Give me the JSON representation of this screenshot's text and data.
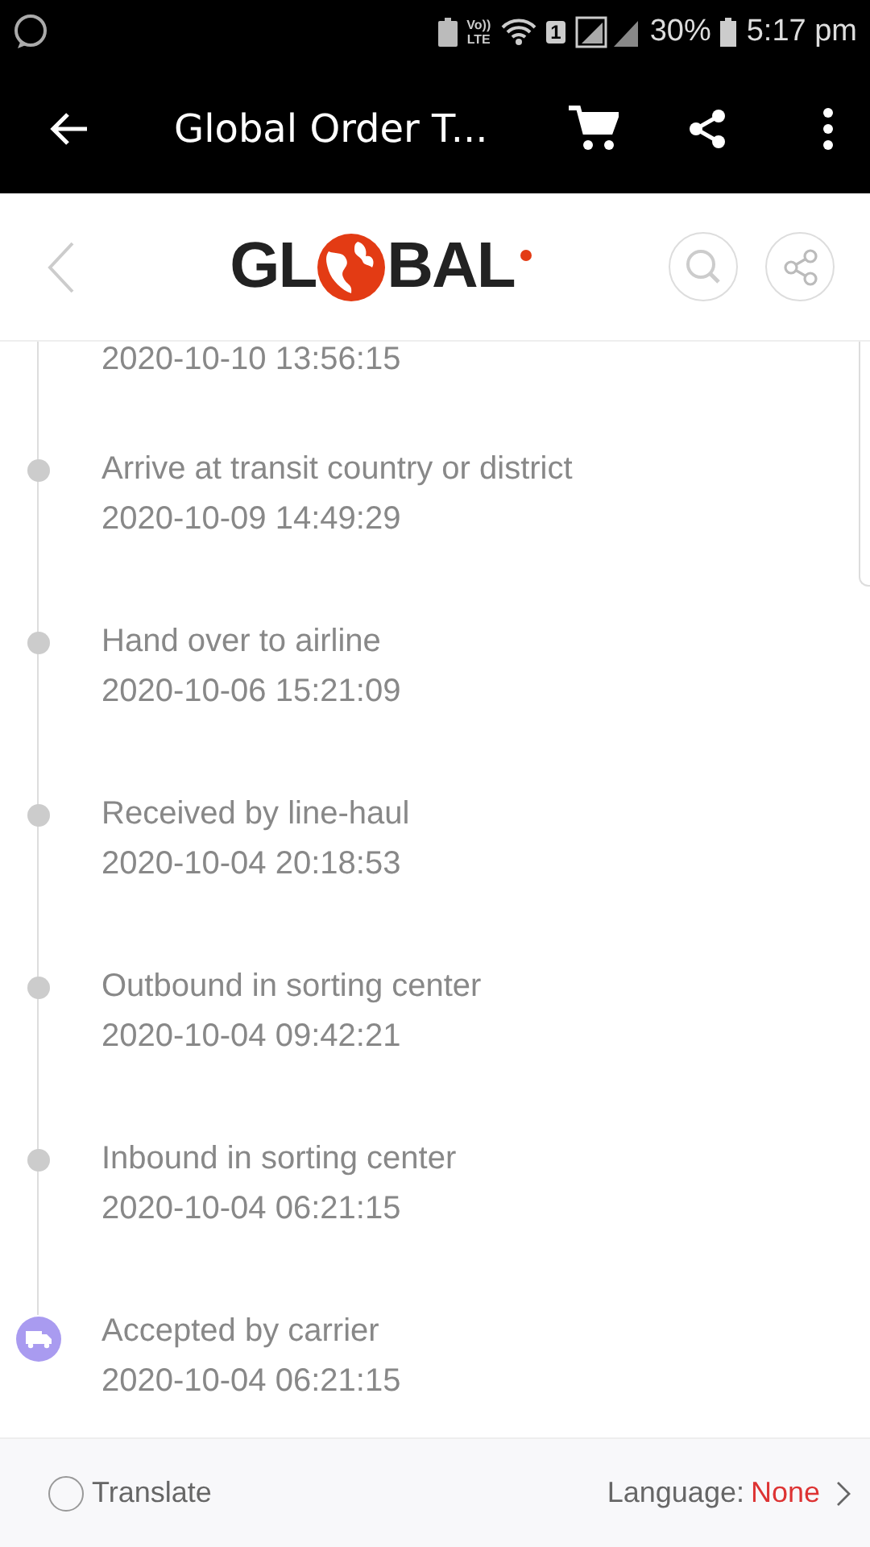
{
  "status_bar": {
    "network": "Vo))\nLTE",
    "sim": "1",
    "battery": "30%",
    "time": "5:17 pm"
  },
  "app_bar": {
    "title": "Global Order T..."
  },
  "header": {
    "logo_left": "GL",
    "logo_right": "BAL"
  },
  "timeline": {
    "top_time": "2020-10-10 13:56:15",
    "events": [
      {
        "kind": "step",
        "title": "Arrive at transit country or district",
        "time": "2020-10-09 14:49:29"
      },
      {
        "kind": "step",
        "title": "Hand over to airline",
        "time": "2020-10-06 15:21:09"
      },
      {
        "kind": "step",
        "title": "Received by line-haul",
        "time": "2020-10-04 20:18:53"
      },
      {
        "kind": "step",
        "title": "Outbound in sorting center",
        "time": "2020-10-04 09:42:21"
      },
      {
        "kind": "step",
        "title": "Inbound in sorting center",
        "time": "2020-10-04 06:21:15"
      },
      {
        "kind": "origin",
        "title": "Accepted by carrier",
        "time": "2020-10-04 06:21:15"
      }
    ]
  },
  "footer": {
    "translate": {
      "label": "Translate",
      "checked": false
    },
    "language_label": "Language:",
    "language_value": "None"
  }
}
